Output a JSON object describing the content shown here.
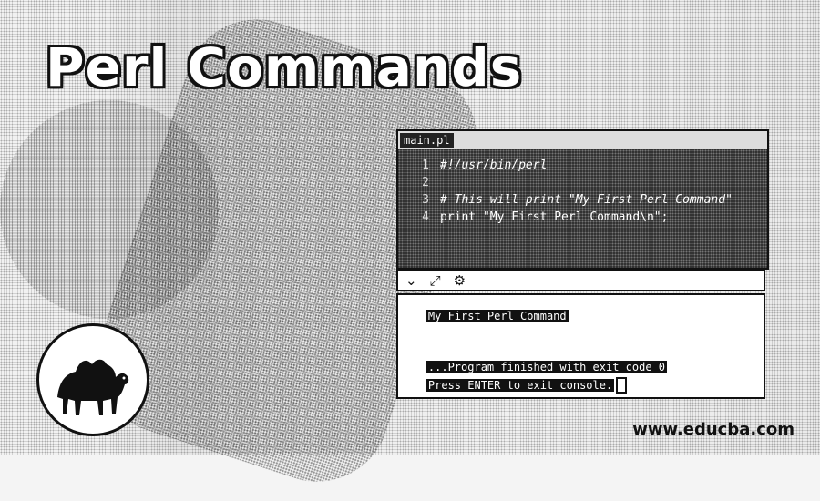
{
  "title": "Perl Commands",
  "editor": {
    "tab_label": "main.pl",
    "lines": [
      {
        "num": "1",
        "text": "#!/usr/bin/perl"
      },
      {
        "num": "2",
        "text": ""
      },
      {
        "num": "3",
        "text": "# This will print \"My First Perl Command\""
      },
      {
        "num": "4",
        "text": "print \"My First Perl Command\\n\";"
      }
    ]
  },
  "toolbar": {
    "icons": [
      "chevron-down-icon",
      "expand-icon",
      "settings-icon"
    ]
  },
  "console": {
    "output_line": "My First Perl Command",
    "finished_line": "...Program finished with exit code 0",
    "prompt_line": "Press ENTER to exit console."
  },
  "watermark": "www.educba.com"
}
